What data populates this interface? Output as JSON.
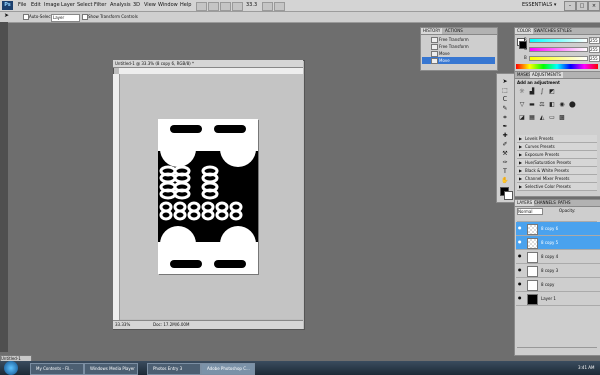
{
  "menubar": {
    "logo": "Ps",
    "items": [
      "File",
      "Edit",
      "Image",
      "Layer",
      "Select",
      "Filter",
      "Analysis",
      "3D",
      "View",
      "Window",
      "Help"
    ],
    "workspace": "ESSENTIALS ▾",
    "zoom": "33.3"
  },
  "options": {
    "auto_select_label": "Auto-Select:",
    "layer_dropdown": "Layer",
    "show_transform_label": "Show Transform Controls"
  },
  "document": {
    "title": "Untitled-1 @ 33.3% (8 copy 6, RGB/8) *",
    "zoom": "33.33%",
    "status": "Doc: 17.2M/6.00M"
  },
  "history": {
    "tabs": [
      "HISTORY",
      "ACTIONS"
    ],
    "items": [
      "Free Transform",
      "Free Transform",
      "Move",
      "Move"
    ]
  },
  "color_panel": {
    "tabs": [
      "COLOR",
      "SWATCHES",
      "STYLES"
    ],
    "channels": [
      {
        "label": "R",
        "value": "255"
      },
      {
        "label": "G",
        "value": "255"
      },
      {
        "label": "B",
        "value": "255"
      }
    ]
  },
  "adjustments": {
    "tabs": [
      "MASKS",
      "ADJUSTMENTS"
    ],
    "heading": "Add an adjustment",
    "presets": [
      "Levels Presets",
      "Curves Presets",
      "Exposure Presets",
      "Hue/Saturation Presets",
      "Black & White Presets",
      "Channel Mixer Presets",
      "Selective Color Presets"
    ]
  },
  "layers": {
    "tabs": [
      "LAYERS",
      "CHANNELS",
      "PATHS"
    ],
    "blend_mode": "Normal",
    "opacity_label": "Opacity:",
    "items": [
      {
        "name": "8 copy 6",
        "selected": true
      },
      {
        "name": "8 copy 5",
        "selected": true
      },
      {
        "name": "8 copy 4",
        "selected": false
      },
      {
        "name": "8 copy 3",
        "selected": false
      },
      {
        "name": "8 copy",
        "selected": false
      },
      {
        "name": "Layer 1",
        "selected": false
      }
    ]
  },
  "taskbar": {
    "items": [
      "My Contents - Fil...",
      "Windows Media Player",
      "Photos Entry 3",
      "Adobe Photoshop C..."
    ],
    "clock": "3:41 AM",
    "mini_doc": "Untitled-1"
  }
}
